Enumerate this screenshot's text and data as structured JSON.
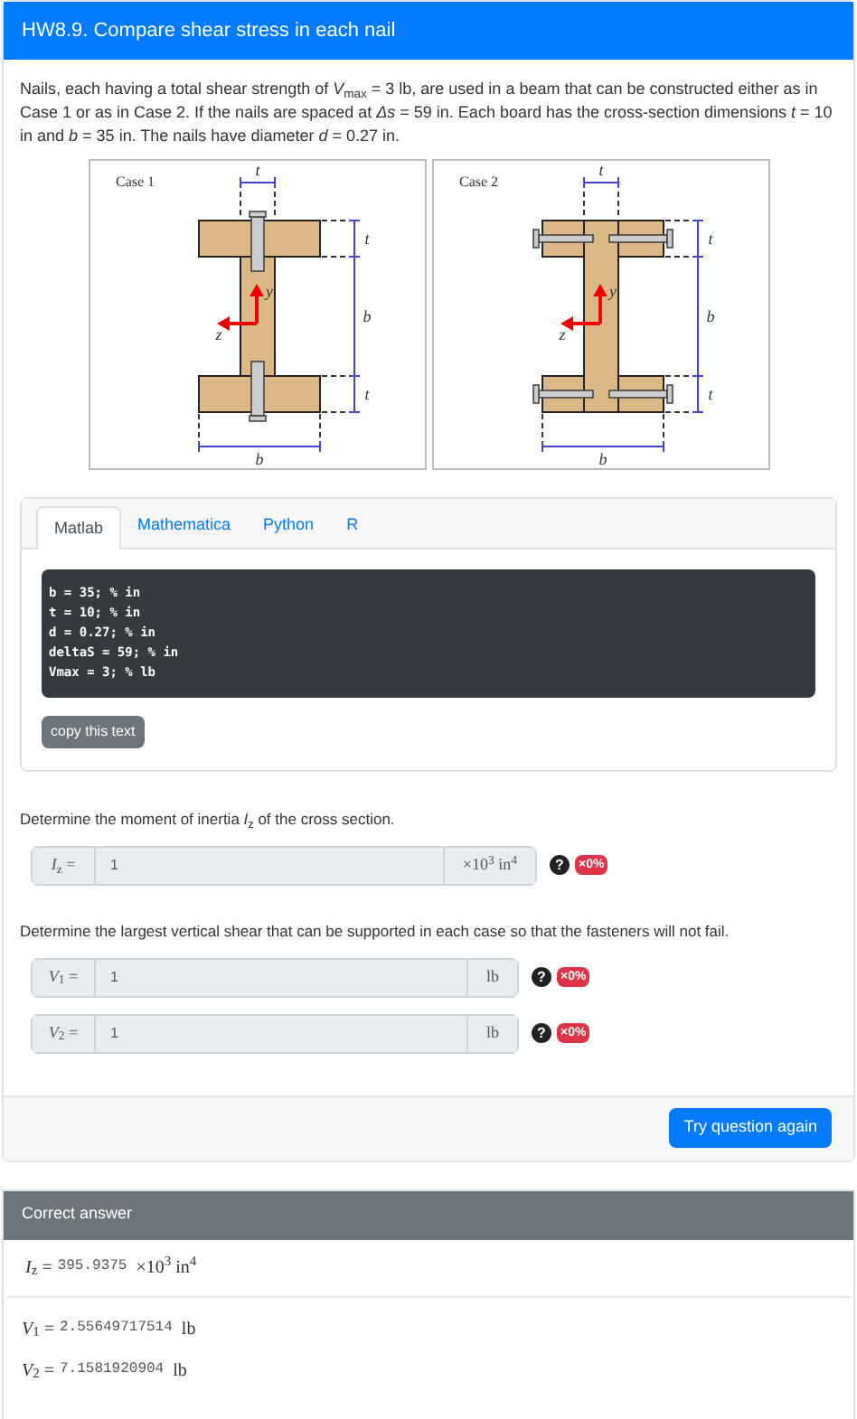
{
  "header": {
    "title": "HW8.9. Compare shear stress in each nail"
  },
  "statement": "Nails, each having a total shear strength of *V*$_{max}$ = 3 lb, are used in a beam that can be constructed either as in Case 1 or as in Case 2. If the nails are spaced at *Δs* = 59 in. Each board has the cross-section dimensions *t* = 10 in and *b* = 35 in. The nails have diameter *d* = 0.27 in.",
  "figures": [
    {
      "kind": "vertical-nails",
      "caption": "Case 1",
      "top_label": "t",
      "side_labels": [
        "t",
        "b",
        "t"
      ],
      "bottom_label": "b",
      "axis_y": "y",
      "axis_z": "z"
    },
    {
      "kind": "horizontal-nails",
      "caption": "Case 2",
      "top_label": "t",
      "side_labels": [
        "t",
        "b",
        "t"
      ],
      "bottom_label": "b",
      "axis_y": "y",
      "axis_z": "z"
    }
  ],
  "code_tabs": [
    {
      "label": "Matlab",
      "selected": true
    },
    {
      "label": "Mathematica",
      "selected": false
    },
    {
      "label": "Python",
      "selected": false
    },
    {
      "label": "R",
      "selected": false
    }
  ],
  "code_lines": [
    "b = 35; % in",
    "t = 10; % in",
    "d = 0.27; % in",
    "deltaS = 59; % in",
    "Vmax = 3; % lb"
  ],
  "copy_button": "copy this text",
  "questions": [
    {
      "prompt": "Determine the moment of inertia *I*$_{z}$ of the cross section.",
      "inputs": [
        {
          "prefix": "*I*$_{z}$ =",
          "value": "1",
          "unit": "×10$^{3}$ in$^{4}$",
          "help": "?",
          "badge": "×0%"
        }
      ]
    },
    {
      "prompt": "Determine the largest vertical shear that can be supported in each case so that the fasteners will not fail.",
      "inputs": [
        {
          "prefix": "*V*$_{1}$ =",
          "value": "1",
          "unit": "lb",
          "help": "?",
          "badge": "×0%"
        },
        {
          "prefix": "*V*$_{2}$ =",
          "value": "1",
          "unit": "lb",
          "help": "?",
          "badge": "×0%"
        }
      ]
    }
  ],
  "try_button": "Try question again",
  "correct_answer": {
    "title": "Correct answer",
    "answers": [
      {
        "label": "*I*$_{z}$ =",
        "value": "395.9375",
        "unit": "×10$^{3}$ in$^{4}$"
      },
      {
        "label": "*V*$_{1}$ =",
        "value": "2.55649717514",
        "unit": "lb"
      },
      {
        "label": "*V*$_{2}$ =",
        "value": "7.1581920904",
        "unit": "lb"
      }
    ]
  }
}
